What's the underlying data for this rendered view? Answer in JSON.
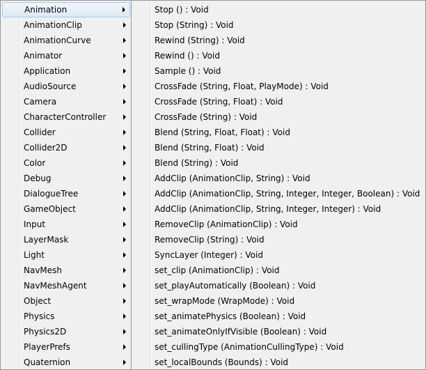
{
  "left_menu": {
    "items": [
      {
        "label": "Animation"
      },
      {
        "label": "AnimationClip"
      },
      {
        "label": "AnimationCurve"
      },
      {
        "label": "Animator"
      },
      {
        "label": "Application"
      },
      {
        "label": "AudioSource"
      },
      {
        "label": "Camera"
      },
      {
        "label": "CharacterController"
      },
      {
        "label": "Collider"
      },
      {
        "label": "Collider2D"
      },
      {
        "label": "Color"
      },
      {
        "label": "Debug"
      },
      {
        "label": "DialogueTree"
      },
      {
        "label": "GameObject"
      },
      {
        "label": "Input"
      },
      {
        "label": "LayerMask"
      },
      {
        "label": "Light"
      },
      {
        "label": "NavMesh"
      },
      {
        "label": "NavMeshAgent"
      },
      {
        "label": "Object"
      },
      {
        "label": "Physics"
      },
      {
        "label": "Physics2D"
      },
      {
        "label": "PlayerPrefs"
      },
      {
        "label": "Quaternion"
      }
    ],
    "highlighted_index": 0,
    "submenu_arrow_icon": "chevron-right-icon"
  },
  "right_menu": {
    "items": [
      {
        "label": "Stop () : Void"
      },
      {
        "label": "Stop (String) : Void"
      },
      {
        "label": "Rewind (String) : Void"
      },
      {
        "label": "Rewind () : Void"
      },
      {
        "label": "Sample () : Void"
      },
      {
        "label": "CrossFade (String, Float, PlayMode) : Void"
      },
      {
        "label": "CrossFade (String, Float) : Void"
      },
      {
        "label": "CrossFade (String) : Void"
      },
      {
        "label": "Blend (String, Float, Float) : Void"
      },
      {
        "label": "Blend (String, Float) : Void"
      },
      {
        "label": "Blend (String) : Void"
      },
      {
        "label": "AddClip (AnimationClip, String) : Void"
      },
      {
        "label": "AddClip (AnimationClip, String, Integer, Integer, Boolean) : Void"
      },
      {
        "label": "AddClip (AnimationClip, String, Integer, Integer) : Void"
      },
      {
        "label": "RemoveClip (AnimationClip) : Void"
      },
      {
        "label": "RemoveClip (String) : Void"
      },
      {
        "label": "SyncLayer (Integer) : Void"
      },
      {
        "label": "set_clip (AnimationClip) : Void"
      },
      {
        "label": "set_playAutomatically (Boolean) : Void"
      },
      {
        "label": "set_wrapMode (WrapMode) : Void"
      },
      {
        "label": "set_animatePhysics (Boolean) : Void"
      },
      {
        "label": "set_animateOnlyIfVisible (Boolean) : Void"
      },
      {
        "label": "set_cullingType (AnimationCullingType) : Void"
      },
      {
        "label": "set_localBounds (Bounds) : Void"
      }
    ]
  },
  "colors": {
    "menu_background": "#f0f0f0",
    "menu_border": "#979797",
    "highlight_border": "#a8c8ed"
  }
}
